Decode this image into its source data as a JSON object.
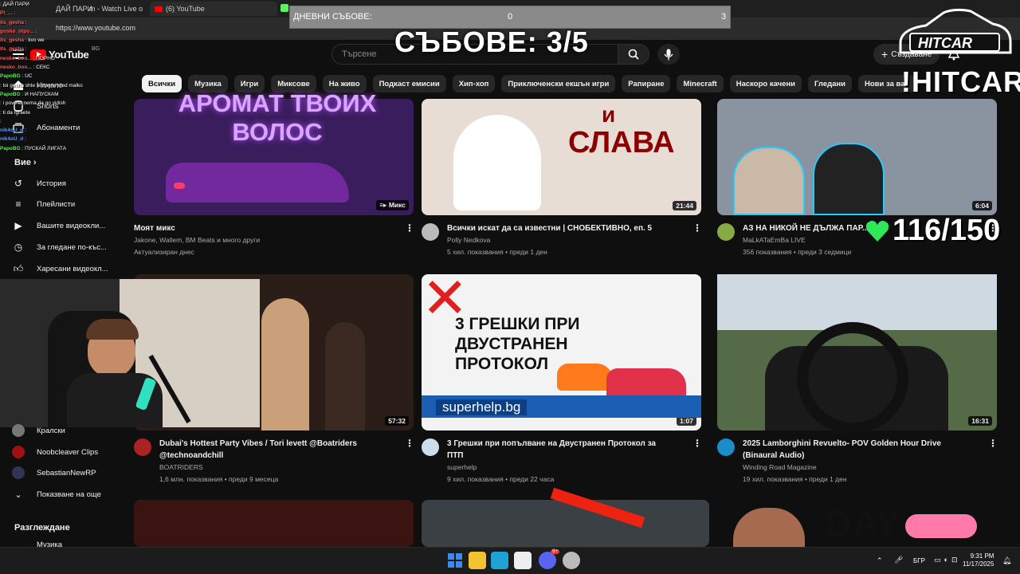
{
  "browser": {
    "tabs": [
      {
        "label": "ДАЙ ПАРИ"
      },
      {
        "label": "m - Watch Live o"
      },
      {
        "label": "(6) YouTube"
      }
    ],
    "url": "https://www.youtube.com"
  },
  "masthead": {
    "logo": "YouTube",
    "region": "BG",
    "search_placeholder": "Търсене",
    "create_label": "Създаване",
    "notifications_count": "6"
  },
  "chips": [
    "Всички",
    "Музика",
    "Игри",
    "Миксове",
    "На живо",
    "Подкаст емисии",
    "Хип-хоп",
    "Приключенски екшън игри",
    "Рапиране",
    "Minecraft",
    "Наскоро качени",
    "Гледани",
    "Нови за вас"
  ],
  "sidebar": {
    "top": [
      {
        "label": "Начало",
        "icon": "home-icon"
      },
      {
        "label": "Shorts",
        "icon": "shorts-icon"
      },
      {
        "label": "Абонаменти",
        "icon": "subscriptions-icon"
      }
    ],
    "you_heading": "Вие",
    "you_items": [
      {
        "label": "История",
        "icon": "history-icon"
      },
      {
        "label": "Плейлисти",
        "icon": "playlist-icon"
      },
      {
        "label": "Вашите видеокли...",
        "icon": "your-videos-icon"
      },
      {
        "label": "За гледане по-къс...",
        "icon": "watch-later-icon"
      },
      {
        "label": "Харесани видеокл...",
        "icon": "liked-icon"
      }
    ],
    "subscriptions": [
      {
        "label": "Кралски"
      },
      {
        "label": "Noobcleaver Clips"
      },
      {
        "label": "SebastianNewRP"
      },
      {
        "label": "Показване на още"
      }
    ],
    "explore_heading": "Разглеждане",
    "explore_first": "Музика"
  },
  "videos": [
    {
      "title": "Моят микс",
      "channel": "Jakone, Wallem, BM Beats и много други",
      "meta": "Актуализиран днес",
      "badge": "Микс",
      "thumb_text": "АРОМАТ ТВОИХ ВОЛОС",
      "color": "#3a1d5c"
    },
    {
      "title": "Всички искат да са известни | СНОБЕКТИВНО, еп. 5",
      "channel": "Polly Nedkova",
      "meta": "5 хил. показвания • преди 1 ден",
      "duration": "21:44",
      "thumb_text": "СЛАВА",
      "thumb_text_small": "и",
      "color": "#e8ddd4"
    },
    {
      "title": "АЗ НА НИКОЙ НЕ ДЪЛЖА ПАР...",
      "channel": "MaLkATaEmBa LIVE",
      "meta": "356 показвания • преди 3 седмици",
      "duration": "6:04",
      "color": "#8a93a0"
    },
    {
      "title": "Dubai's Hottest Party Vibes / Tori levett @Boatriders @technoandchill",
      "channel": "BOATRIDERS",
      "meta": "1,6 млн. показвания • преди 9 месеца",
      "duration": "57:32",
      "color": "#2a1c16"
    },
    {
      "title": "3 Грешки при попълване на Двустранен Протокол за ПТП",
      "channel": "superhelp",
      "meta": "9 хил. показвания • преди 22 часа",
      "duration": "1:07",
      "thumb_text": "3 ГРЕШКИ ПРИ ДВУСТРАНЕН ПРОТОКОЛ",
      "thumb_banner": "superhelp.bg",
      "color": "#f3f3f3"
    },
    {
      "title": "2025 Lamborghini Revuelto- POV Golden Hour Drive (Binaural Audio)",
      "channel": "Winding Road Magazine",
      "meta": "19 хил. показвания • преди 1 ден",
      "duration": "16:31",
      "color": "#556b48"
    }
  ],
  "row3_thumb_text": "DAY",
  "overlay": {
    "daily_label": "ДНЕВНИ СЪБОВЕ:",
    "daily_value": "0",
    "daily_goal": "3",
    "bouts": "СЪБОВЕ: 3/5",
    "brand": "!HITCAR",
    "badge": "HITCAR",
    "likes": "116/150"
  },
  "chat": [
    {
      "user": "",
      "msg": "ДАЙ ПАРИ",
      "color": "#ff5a5a"
    },
    {
      "user": "Pt_...",
      "msg": "",
      "color": "#ff5a5a"
    },
    {
      "user": "its_gesha",
      "msg": "",
      "color": "#ff5a5a"
    },
    {
      "user": "gosho_otpo...",
      "msg": "",
      "color": "#ff5a5a"
    },
    {
      "user": "its_gesha",
      "msg": "kvo we",
      "color": "#ff5a5a"
    },
    {
      "user": "its_gesha",
      "msg": "",
      "color": "#ff5a5a"
    },
    {
      "user": "nesko_boo...",
      "msg": "ПОРНО",
      "color": "#ff5a5a"
    },
    {
      "user": "nesko_boo...",
      "msg": "СЕКС",
      "color": "#ff5a5a"
    },
    {
      "user": "PapoBG",
      "msg": "UC",
      "color": "#5af55a"
    },
    {
      "user": "",
      "msg": "toi gesha shte si trugne sled malko",
      "color": "#5aa0ff"
    },
    {
      "user": "PapoBG",
      "msg": "И НАПУСКАМ",
      "color": "#5af55a"
    },
    {
      "user": "",
      "msg": "i povече nema da go vidish",
      "color": "#5aa0ff"
    },
    {
      "user": "",
      "msg": "ti da Igraete",
      "color": "#5aa0ff"
    },
    {
      "user": "",
      "msg": "",
      "color": "#5aa0ff"
    },
    {
      "user": "nik4oU_d",
      "msg": "",
      "color": "#5aa0ff"
    },
    {
      "user": "nik4oU_d",
      "msg": "",
      "color": "#5aa0ff"
    },
    {
      "user": "PapoBG",
      "msg": "ПУСКАЙ ЛИГАТА",
      "color": "#5af55a"
    }
  ],
  "taskbar": {
    "lang": "БГР",
    "time": "9:31 PM",
    "date": "11/17/2025",
    "discord_badge": "9+"
  }
}
